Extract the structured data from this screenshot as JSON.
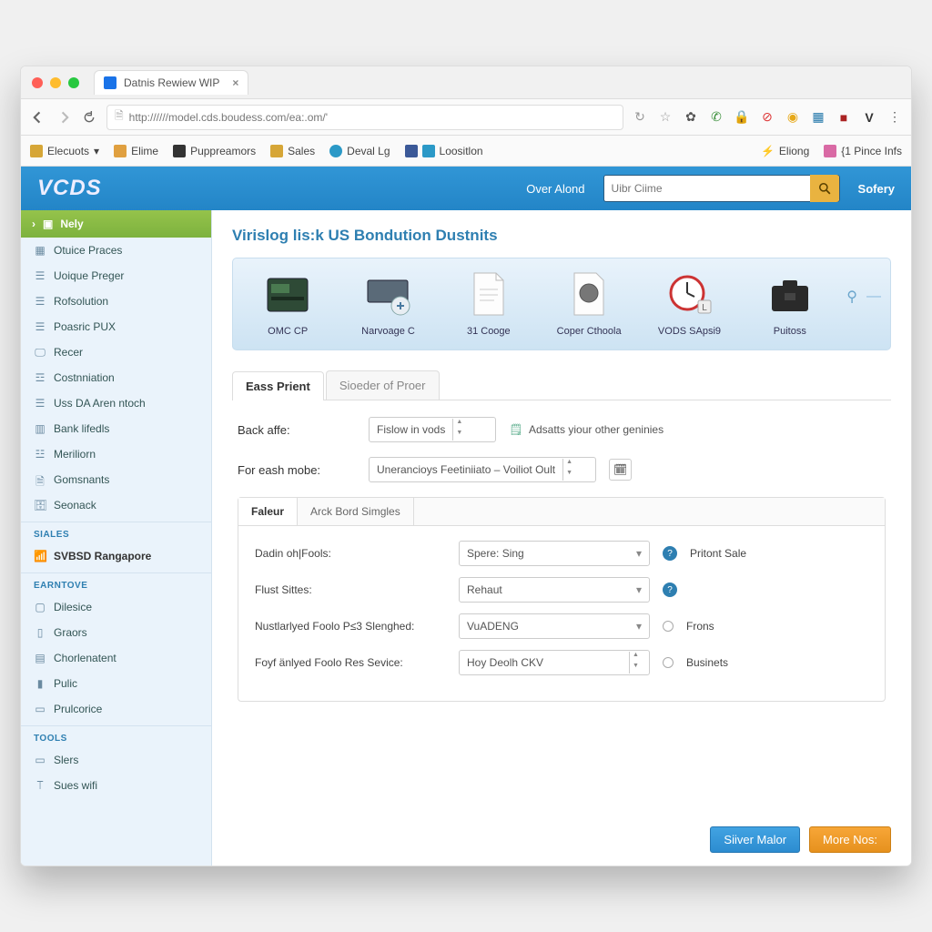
{
  "browser": {
    "tab_title": "Datnis Rewiew WIP",
    "url": "http://////model.cds.boudess.com/ea:.om/'"
  },
  "bookmarks": {
    "left": [
      {
        "name": "Elecuots",
        "caret": true,
        "color": "#d6a637"
      },
      {
        "name": "Elime",
        "caret": false,
        "color": "#e0a040"
      },
      {
        "name": "Puppreamors",
        "caret": false,
        "color": "#333333"
      },
      {
        "name": "Sales",
        "caret": false,
        "color": "#d6a637"
      },
      {
        "name": "Deval Lg",
        "caret": false,
        "color": "#2b99c7"
      },
      {
        "name": "Loositlon",
        "caret": false,
        "color": "#2b99c7"
      }
    ],
    "right": [
      {
        "name": "Eliong",
        "color": "#88bb55"
      },
      {
        "name": "{1 Pince Infs",
        "color": "#d96aa5"
      }
    ]
  },
  "appbar": {
    "brand": "VCDS",
    "over_label": "Over Alond",
    "search_placeholder": "Uibr Ciime",
    "safety_label": "Sofery"
  },
  "sidebar": {
    "top": "Nely",
    "items_main": [
      "Otuice Praces",
      "Uoique Preger",
      "Rofsolution",
      "Poasric PUX",
      "Recer",
      "Costnniation",
      "Uss DA Aren ntoch",
      "Bank lifedls",
      "Meriliorn",
      "Gomsnants",
      "Seonack"
    ],
    "section_sales": "SIALES",
    "sales_item": "SVBSD Rangapore",
    "section_earn": "EARNTOVE",
    "earn_items": [
      "Dilesice",
      "Graors",
      "Chorlenatent",
      "Pulic",
      "Prulcorice"
    ],
    "section_tools": "TOOLS",
    "tools_items": [
      "Slers",
      "Sues wifi"
    ]
  },
  "main": {
    "title": "Virislog lis:k US Bondution Dustnits",
    "launch_items": [
      "OMC CP",
      "Narvoage C",
      "31 Cooge",
      "Coper Cthoola",
      "VODS SApsi9",
      "Puitoss"
    ],
    "tabs_outer": [
      "Eass Prient",
      "Sioeder of Proer"
    ],
    "form": {
      "back_label": "Back affe:",
      "back_value": "Fislow in vods",
      "back_hint": "Adsatts yiour other geninies",
      "cash_label": "For eash mobe:",
      "cash_value": "Unerancioys Feetiniiato – Voiliot Oult"
    },
    "subtabs": [
      "Faleur",
      "Arck Bord Simgles"
    ],
    "subform": [
      {
        "label": "Dadin oh|Fools:",
        "value": "Spere: Sing",
        "after_type": "info_text",
        "after_text": "Pritont Sale"
      },
      {
        "label": "Flust Sittes:",
        "value": "Rehaut",
        "after_type": "info",
        "after_text": ""
      },
      {
        "label": "Nustlarlyed Foolo P≤3 Slenghed:",
        "value": "VuADENG",
        "after_type": "radio",
        "after_text": "Frons"
      },
      {
        "label": "Foyf änlyed Foolo Res Sevice:",
        "value": "Hoy Deolh CKV",
        "after_type": "radio",
        "after_text": "Businets"
      }
    ],
    "footer": {
      "primary": "Siiver Malor",
      "warn": "More Nos:"
    }
  }
}
